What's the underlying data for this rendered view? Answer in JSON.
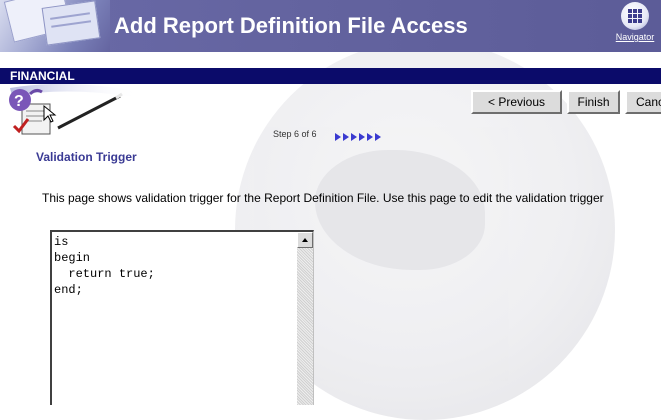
{
  "header": {
    "title": "Add Report Definition File Access",
    "navigator_label": "Navigator",
    "navigator_icon": "navigator-grid-icon"
  },
  "band": {
    "label": "FINANCIAL"
  },
  "wizard": {
    "icon": "wizard-help-icon",
    "buttons": {
      "previous": "< Previous",
      "finish": "Finish",
      "cancel": "Canc"
    },
    "step_text": "Step 6 of 6",
    "step_arrows": "step-progress-arrows-icon"
  },
  "section": {
    "title": "Validation Trigger",
    "description": "This page shows validation trigger for the Report Definition File. Use this page to edit the validation trigger"
  },
  "editor": {
    "value": "is\nbegin\n  return true;\nend;"
  },
  "colors": {
    "header_bg": "#6464a0",
    "band_bg": "#0b0b6a",
    "section_title": "#3a3a94",
    "button_face": "#dcdcdc"
  }
}
